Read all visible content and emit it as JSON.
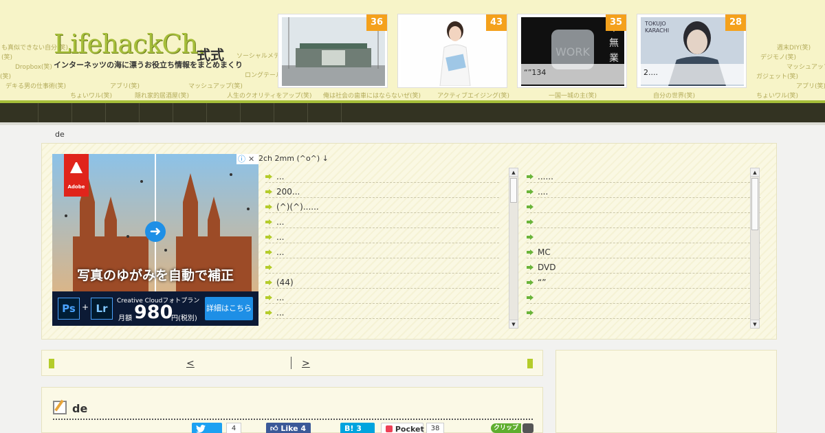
{
  "header": {
    "logo_main": "LifehackCh.",
    "logo_suffix": "式式",
    "tagline": "インターネッツの海に漂うお役立ち情報をまとめまくり",
    "tags": [
      "も真似できない自分(笑)",
      "(笑)",
      "Dropbox(笑)",
      "(笑)",
      "デキる男の仕事術(笑)",
      "ちょいワル(笑)",
      "隠れ家的居酒屋(笑)",
      "人生のクオリティをアップ(笑)",
      "俺は社会の歯車にはならないぜ(笑)",
      "アクティブエイジング(笑)",
      "一国一城の主(笑)",
      "自分の世界(笑)",
      "ちょいワル(笑)",
      "ソーシャルメデ",
      "ロングテール",
      "マッシュアップ(笑)",
      "アブリ(笑)",
      "デジモノ(笑)",
      "週末DIY(笑)",
      "マッシュアップ",
      "ガジェット(笑)",
      "アプリ(笑)"
    ]
  },
  "thumbs": [
    {
      "count": "36",
      "caption": ""
    },
    {
      "count": "43",
      "caption": ""
    },
    {
      "count": "35",
      "caption": "“”134"
    },
    {
      "count": "28",
      "caption": "2...."
    }
  ],
  "breadcrumb": "de",
  "ad": {
    "brand": "Adobe",
    "headline": "写真のゆがみを自動で補正",
    "plan": "Creative Cloudフォトプラン",
    "price_label": "月額",
    "price": "980",
    "price_unit": "円(税別)",
    "cta": "詳細はこちら",
    "ps": "Ps",
    "lr": "Lr",
    "plus": "+",
    "choices": "ⓘ",
    "close": "✕",
    "arrow": "➜"
  },
  "rss_box": {
    "title": "2ch  2mm (^o^)  ↓",
    "left_items": [
      "...",
      "200...",
      "(^)(^)......",
      "...",
      "...",
      "...",
      "",
      "(44)",
      "...",
      "..."
    ],
    "right_items": [
      "......",
      "....",
      "",
      "",
      "",
      "MC",
      "DVD",
      "“”",
      "",
      ""
    ]
  },
  "pager": {
    "prev": "<                    ",
    "next": ">              "
  },
  "article": {
    "title": "de"
  },
  "share": {
    "tweet_count": "4",
    "like_label": "Like 4",
    "hatena_label": "B! 3",
    "pocket_label": "Pocket",
    "pocket_count": "38",
    "clip_label": "クリップ"
  },
  "colors": {
    "accent": "#a6be3a",
    "navbar": "#333322",
    "badge": "#f4a11c",
    "twitter": "#1da1f2",
    "facebook": "#3b5998",
    "hatena": "#00a4de",
    "pocket": "#ee4056"
  }
}
